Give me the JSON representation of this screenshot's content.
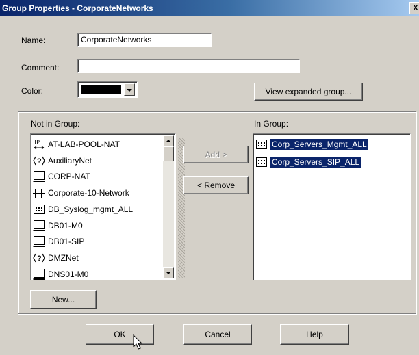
{
  "window": {
    "title": "Group Properties - CorporateNetworks",
    "close_glyph": "x"
  },
  "form": {
    "name_label": "Name:",
    "name_value": "CorporateNetworks",
    "comment_label": "Comment:",
    "comment_value": "",
    "color_label": "Color:",
    "color_value": "#000000",
    "view_expanded_label": "View expanded group..."
  },
  "not_in_group": {
    "label": "Not in Group:",
    "items": [
      {
        "label": "AT-LAB-POOL-NAT",
        "icon": "ip-range-icon"
      },
      {
        "label": "AuxiliaryNet",
        "icon": "dynamic-object-icon"
      },
      {
        "label": "CORP-NAT",
        "icon": "host-icon"
      },
      {
        "label": "Corporate-10-Network",
        "icon": "network-icon"
      },
      {
        "label": "DB_Syslog_mgmt_ALL",
        "icon": "group-icon"
      },
      {
        "label": "DB01-M0",
        "icon": "host-icon"
      },
      {
        "label": "DB01-SIP",
        "icon": "host-icon"
      },
      {
        "label": "DMZNet",
        "icon": "dynamic-object-icon"
      },
      {
        "label": "DNS01-M0",
        "icon": "host-icon"
      }
    ],
    "new_button": "New..."
  },
  "middle": {
    "add_label": "Add  >",
    "remove_label": "< Remove"
  },
  "in_group": {
    "label": "In Group:",
    "items": [
      {
        "label": "Corp_Servers_Mgmt_ALL",
        "icon": "group-icon"
      },
      {
        "label": "Corp_Servers_SIP_ALL",
        "icon": "group-icon"
      }
    ]
  },
  "footer": {
    "ok_label": "OK",
    "cancel_label": "Cancel",
    "help_label": "Help"
  }
}
